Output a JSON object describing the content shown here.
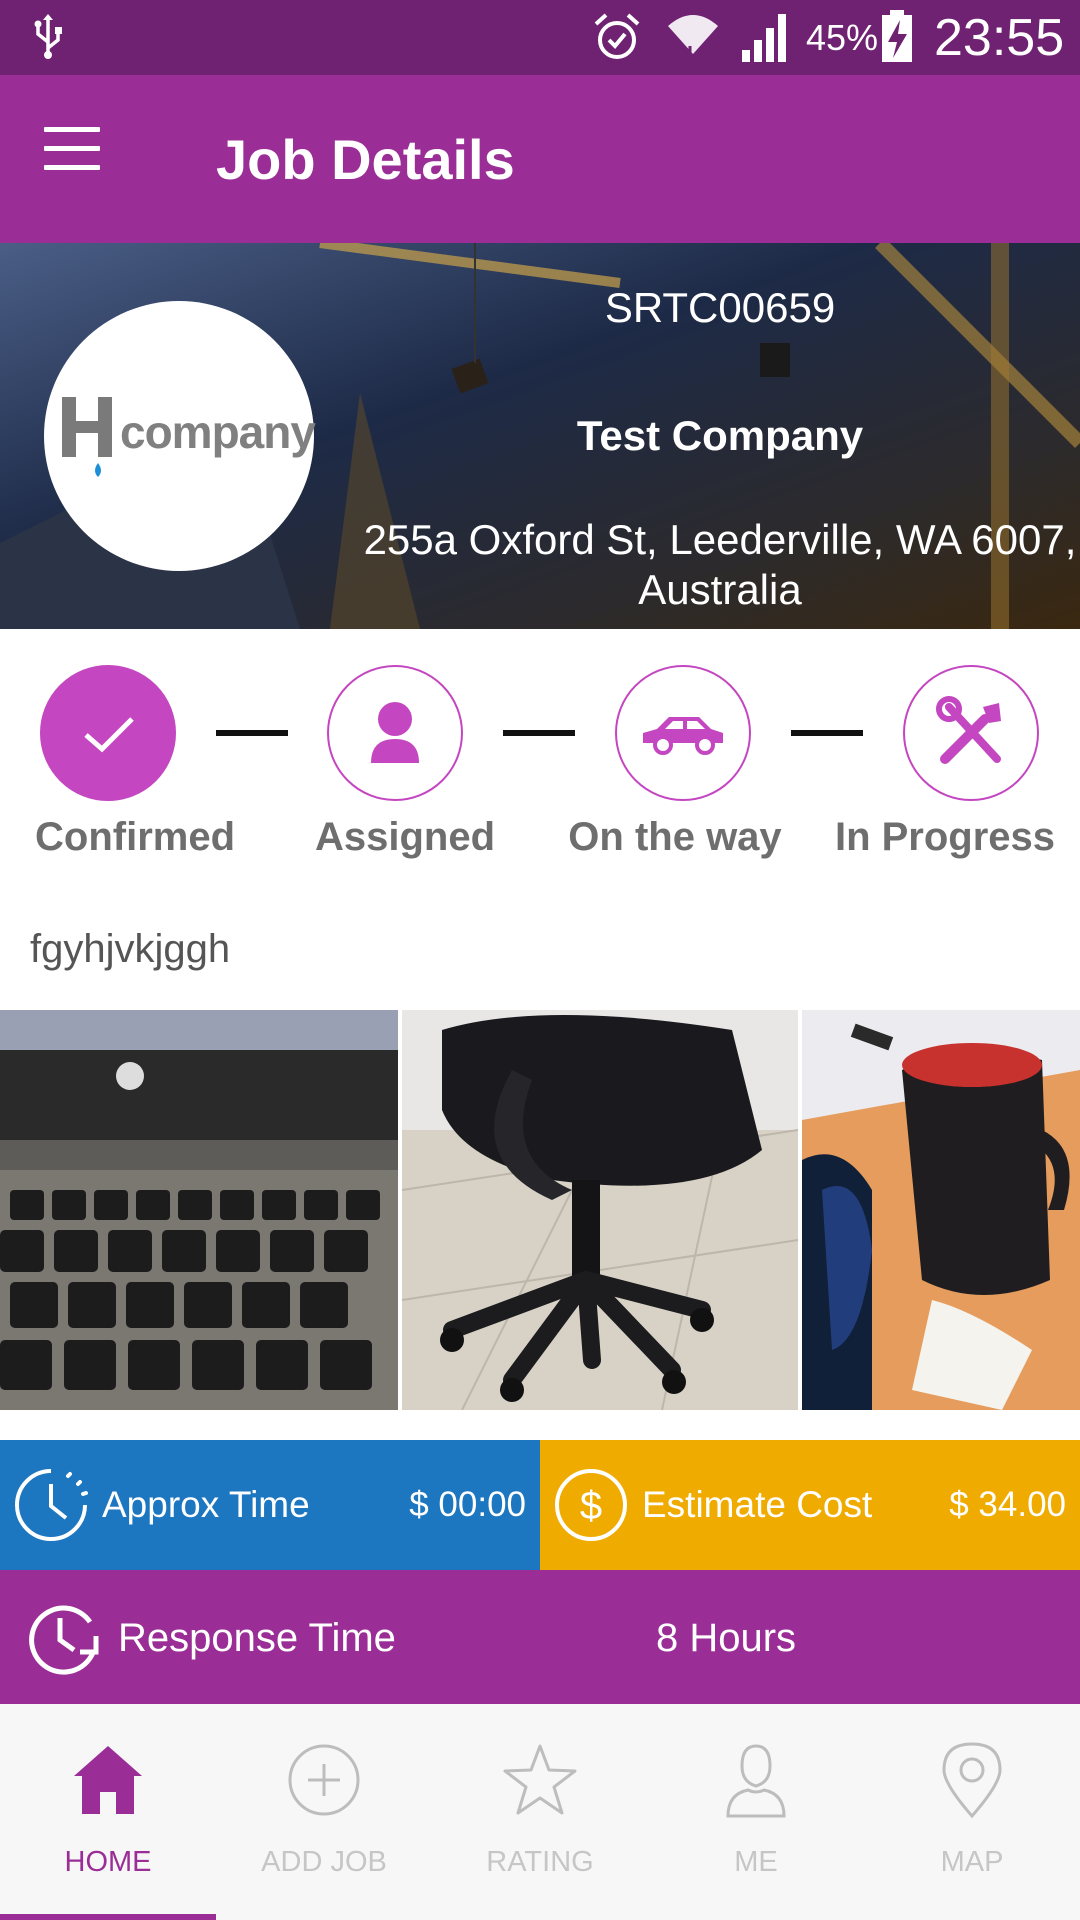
{
  "status_bar": {
    "battery_percent": "45%",
    "time": "23:55",
    "icons": [
      "usb-icon",
      "alarm-icon",
      "wifi-icon",
      "signal-icon",
      "battery-charging-icon"
    ]
  },
  "app_bar": {
    "title": "Job Details",
    "menu_icon": "menu-icon"
  },
  "job": {
    "id": "SRTC00659",
    "company_name": "Test Company",
    "address": "255a Oxford St, Leederville, WA 6007, Australia",
    "logo_text": "company",
    "description": "fgyhjvkjggh"
  },
  "steps": [
    {
      "label": "Confirmed",
      "icon": "check-icon",
      "active": true
    },
    {
      "label": "Assigned",
      "icon": "person-icon",
      "active": false
    },
    {
      "label": "On the way",
      "icon": "car-icon",
      "active": false
    },
    {
      "label": "In Progress",
      "icon": "tools-icon",
      "active": false
    }
  ],
  "photos": [
    "laptop-keyboard-photo",
    "office-chair-photo",
    "mug-desk-photo"
  ],
  "info": {
    "approx_time_label": "Approx Time",
    "approx_time_value": "$ 00:00",
    "estimate_cost_label": "Estimate Cost",
    "estimate_cost_value": "$ 34.00",
    "response_time_label": "Response Time",
    "response_time_value": "8 Hours"
  },
  "bottom_nav": [
    {
      "label": "HOME",
      "icon": "home-icon",
      "active": true
    },
    {
      "label": "ADD JOB",
      "icon": "add-circle-icon",
      "active": false
    },
    {
      "label": "RATING",
      "icon": "star-icon",
      "active": false
    },
    {
      "label": "ME",
      "icon": "profile-icon",
      "active": false
    },
    {
      "label": "MAP",
      "icon": "map-pin-icon",
      "active": false
    }
  ],
  "colors": {
    "status_bar": "#6f2271",
    "primary": "#9a2e96",
    "step_accent": "#c446c0",
    "approx_time_bg": "#1c76c0",
    "estimate_cost_bg": "#f0ab00",
    "nav_inactive": "#c6c6c6"
  }
}
